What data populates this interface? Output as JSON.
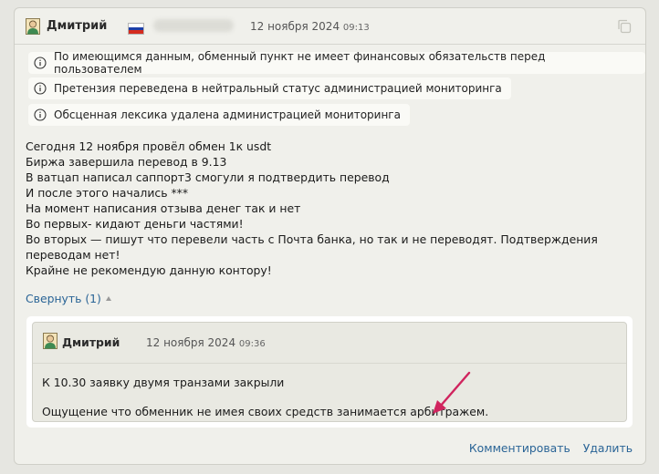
{
  "comment": {
    "author": "Дмитрий",
    "date": "12 ноября 2024",
    "time": "09:13",
    "flag_colors": [
      "#ffffff",
      "#1c3fa8",
      "#d52b1e"
    ],
    "notices": [
      "По имеющимся данным, обменный пункт не имеет финансовых обязательств перед пользователем",
      "Претензия переведена в нейтральный статус администрацией мониторинга",
      "Обсценная лексика удалена администрацией мониторинга"
    ],
    "body_lines": [
      "Сегодня 12 ноября провёл обмен 1к usdt",
      "Биржа завершила перевод в 9.13",
      "В ватцап написал саппорт3 смогули я подтвердить перевод",
      "И после этого начались ***",
      "На момент написания отзыва денег так и нет",
      "Во первых- кидают деньги частями!",
      "Во вторых — пишут что перевели часть с Почта банка, но так и не переводят. Подтверждения переводам нет!",
      "Крайне не рекомендую данную контору!"
    ],
    "collapse_label": "Свернуть (1)"
  },
  "reply": {
    "author": "Дмитрий",
    "date": "12 ноября 2024",
    "time": "09:36",
    "line1": "К 10.30 заявку двумя транзами закрыли",
    "line2": "Ощущение что обменник не имея своих средств занимается арбитражем."
  },
  "actions": {
    "comment_label": "Комментировать",
    "delete_label": "Удалить"
  },
  "colors": {
    "link": "#2a6496",
    "annotation_arrow": "#d0245e"
  }
}
